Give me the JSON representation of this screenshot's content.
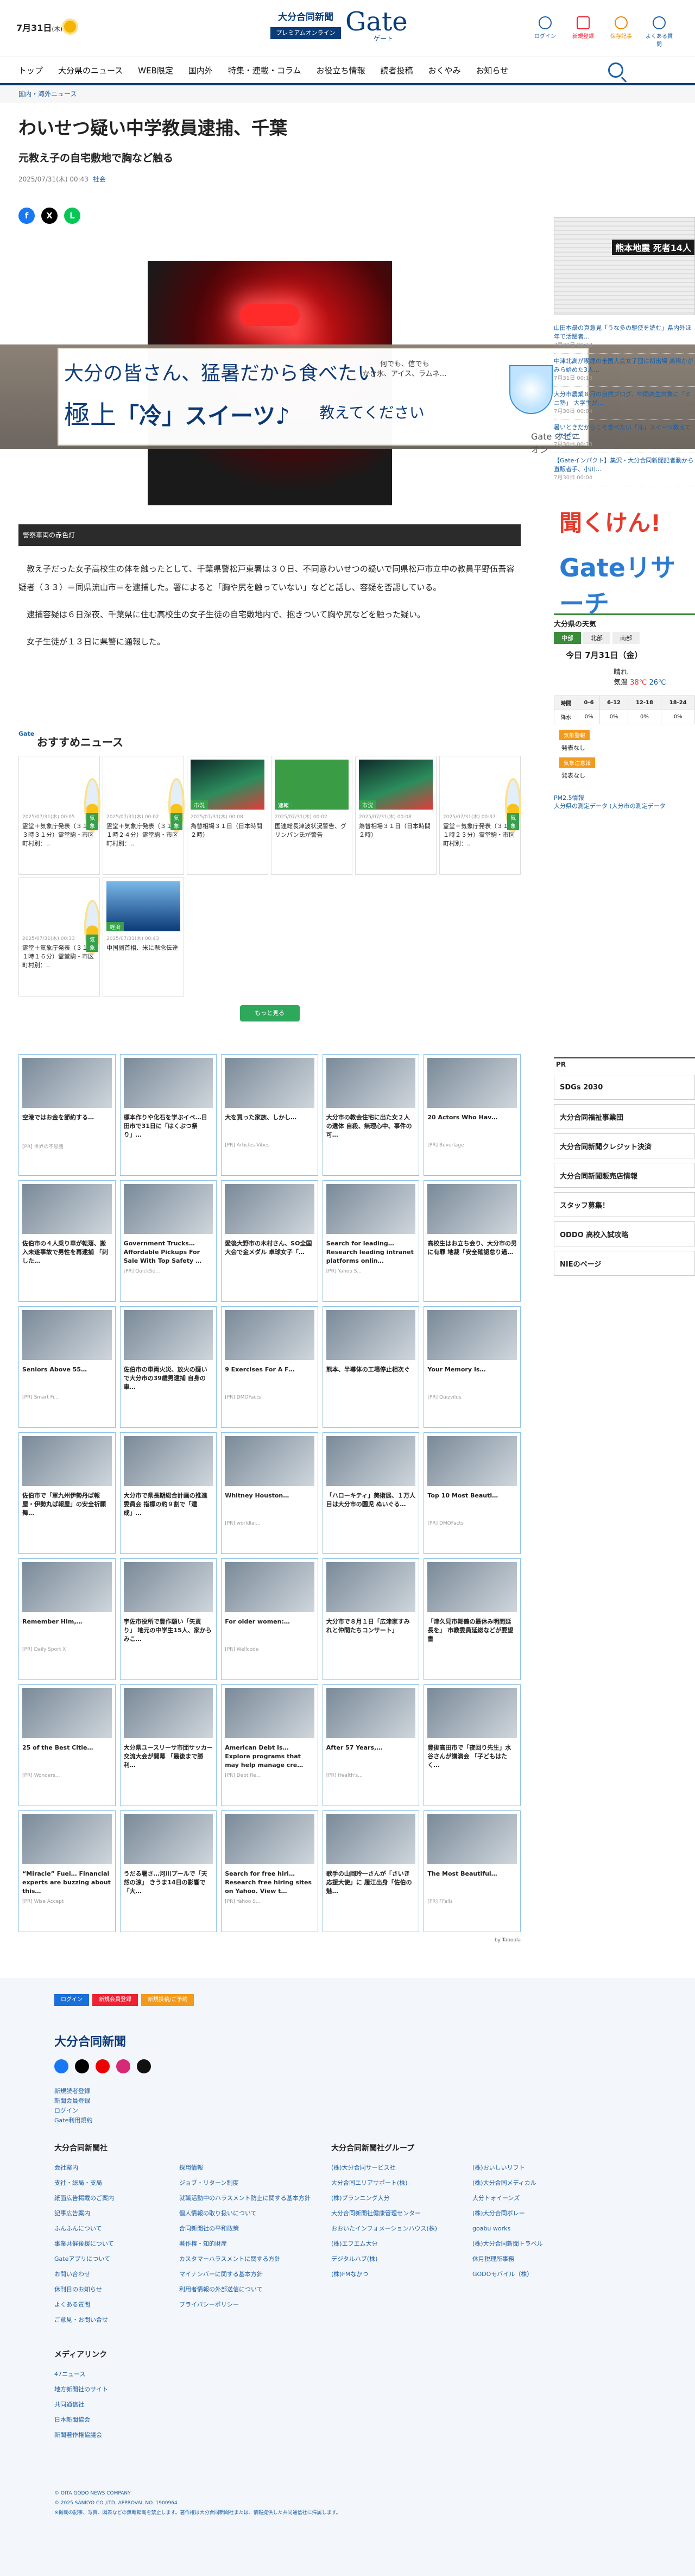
{
  "header": {
    "date": "7月31日",
    "weekday": "(木)",
    "logo_top": "大分合同新聞",
    "logo_sub": "プレミアムオンライン",
    "logo_main": "Gate",
    "logo_kana": "ゲート",
    "icons": [
      {
        "name": "login-icon",
        "label": "ログイン"
      },
      {
        "name": "register-icon",
        "label": "新規登録"
      },
      {
        "name": "bookmark-icon",
        "label": "保存記事"
      },
      {
        "name": "help-icon",
        "label": "よくある質問"
      }
    ]
  },
  "nav": [
    "トップ",
    "大分県のニュース",
    "WEB限定",
    "国内外",
    "特集・連載・コラム",
    "お役立ち情報",
    "読者投稿",
    "おくやみ",
    "お知らせ"
  ],
  "breadcrumb": "国内・海外ニュース",
  "article": {
    "title": "わいせつ疑い中学教員逮捕、千葉",
    "subtitle": "元教え子の自宅敷地で胸など触る",
    "date": "2025/07/31(木) 00:43",
    "tag": "社会",
    "caption": "警察車両の赤色灯",
    "paragraphs": [
      "教え子だった女子高校生の体を触ったとして、千葉県警松戸東署は３０日、不同意わいせつの疑いで同県松戸市立中の教員平野伍吾容疑者（３３）＝同県流山市＝を逮捕した。署によると「胸や尻を触っていない」などと話し、容疑を否認している。",
      "逮捕容疑は６日深夜、千葉県に住む高校生の女子生徒の自宅敷地内で、抱きついて胸や尻などを触った疑い。",
      "女子生徒が１３日に県警に通報した。"
    ]
  },
  "ad": {
    "line1": "大分の皆さん、猛暑だから食べたい",
    "line2a": "極上",
    "line2b": "「冷」スイーツ♪",
    "line3": "教えてください",
    "side_text": "何でも、信でも\nかき氷、アイス、ラムネ…",
    "footer": "Gate オピニオン"
  },
  "recommend": {
    "title": "おすすめニュース",
    "more": "もっと見る",
    "cards": [
      {
        "tag": "気象",
        "time": "2025/07/31(木) 00:05",
        "text": "霊堂＋気象庁発表（３１日３時３１分）霊堂駒・市区町村別：..",
        "kind": "sun"
      },
      {
        "tag": "気象",
        "time": "2025/07/31(木) 00:02",
        "text": "霊堂＋気象庁発表（３１日１時２４分）霊堂駒・市区町村別：..",
        "kind": "sun"
      },
      {
        "tag": "市況",
        "time": "2025/07/31(木) 00:08",
        "text": "為替相場３１日（日本時間２時）",
        "kind": "stock"
      },
      {
        "tag": "速報",
        "time": "2025/07/31(木) 00:02",
        "text": "国連総長津波状況警告、グリンパン氏が警告",
        "kind": "flash"
      },
      {
        "tag": "市況",
        "time": "2025/07/31(木) 00:08",
        "text": "為替相場３１日（日本時間２時）",
        "kind": "stock"
      },
      {
        "tag": "気象",
        "time": "2025/07/31(木) 00:37",
        "text": "霊堂＋気象庁発表（３１日１時２３分）霊堂駒・市区町村別：..",
        "kind": "sun"
      },
      {
        "tag": "気象",
        "time": "2025/07/31(木) 00:33",
        "text": "霊堂＋気象庁発表（３１日１時１６分）霊堂駒・市区町村別：..",
        "kind": "sun"
      },
      {
        "tag": "経済",
        "time": "2025/07/31(木) 00:43",
        "text": "中国副首相、米に懸念伝達",
        "kind": "city"
      }
    ]
  },
  "taboola": {
    "by": "by Taboola",
    "cards": [
      {
        "title": "空港ではお金を節約する…",
        "src": "[PR] 世界の不思議"
      },
      {
        "title": "標本作りや化石を学ぶイベ…日田市で31日に「はくぶつ祭り」…",
        "src": ""
      },
      {
        "title": "大を買った家族、しかし…",
        "src": "[PR] Articles Vibes"
      },
      {
        "title": "大分市の教会住宅に出た女２人の遺体 自殺、無理心中、事件の可…",
        "src": ""
      },
      {
        "title": "20 Actors Who Hav…",
        "src": "[PR] Beverlage"
      },
      {
        "title": "佐伯市の４人乗り車が転落、搬入未遂事故で男性を再逮捕 「刺した…",
        "src": ""
      },
      {
        "title": "Government Trucks… Affordable Pickups For Sale With Top Safety …",
        "src": "[PR] QuickSe..."
      },
      {
        "title": "愛後大野市の木村さん、SO全国大会で金メダル 卓球女子「…",
        "src": ""
      },
      {
        "title": "Search for leading… Research leading intranet platforms onlin…",
        "src": "[PR] Yahoo S..."
      },
      {
        "title": "高校生はお立ち会り、大分市の男に有罪 地裁「安全確認怠り過…",
        "src": ""
      },
      {
        "title": "Seniors Above 55…",
        "src": "[PR] Smart Fi..."
      },
      {
        "title": "佐伯市の車両火災、放火の疑いで大分市の39歳男逮捕 自身の車…",
        "src": ""
      },
      {
        "title": "9 Exercises For A F…",
        "src": "[PR] DMOFacts"
      },
      {
        "title": "熊本、半導体の工場停止相次ぐ",
        "src": ""
      },
      {
        "title": "Your Memory Is…",
        "src": "[PR] Quizvilus"
      },
      {
        "title": "佐伯市で「軍九州伊勢丹ば報屋・伊勢丸ば報屋」の安全祈願 舞…",
        "src": ""
      },
      {
        "title": "大分市で県長期総合計画の推進委員会 指標の約９割で「達成」…",
        "src": ""
      },
      {
        "title": "Whitney Houston…",
        "src": "[PR] worldlai..."
      },
      {
        "title": "「ハローキティ」美術展、１万人目は大分市の園児 ぬいぐる…",
        "src": ""
      },
      {
        "title": "Top 10 Most Beauti…",
        "src": "[PR] DMOFacts"
      },
      {
        "title": "Remember Him,…",
        "src": "[PR] Daily Sport X"
      },
      {
        "title": "宇佐市役所で豊作願い「矢貢り」 地元の中学生15人、家からみこ…",
        "src": ""
      },
      {
        "title": "For older women:…",
        "src": "[PR] Wellcode"
      },
      {
        "title": "大分市で８月１日「広津家すみれと仲間たちコンサート」",
        "src": ""
      },
      {
        "title": "「津久見市舞鶴の最休み明問延長を」 市教委員延総などが要望書",
        "src": ""
      },
      {
        "title": "25 of the Best Citie…",
        "src": "[PR] Wonders..."
      },
      {
        "title": "大分県ユースリーサ市団サッカー交流大会が開幕 「最後まで勝利…",
        "src": ""
      },
      {
        "title": "American Debt Is… Explore programs that may help manage cre…",
        "src": "[PR] Debt Re..."
      },
      {
        "title": "After 57 Years,…",
        "src": "[PR] Health's..."
      },
      {
        "title": "豊後高田市で「夜回り先生」水谷さんが講演会 「子どもはたく…",
        "src": ""
      },
      {
        "title": "“Miracle” Fuel… Financial experts are buzzing about this…",
        "src": "[PR] Wise Accept"
      },
      {
        "title": "うだる暑さ…河川プールで「天然の涼」 きうま14日の影響で「大…",
        "src": ""
      },
      {
        "title": "Search for free hiri… Research free hiring sites on Yahoo. View t…",
        "src": "[PR] Yahoo S..."
      },
      {
        "title": "歌手の山岡玲一さんが「さいき応援大使」に 履江出身「佐伯の魅…",
        "src": ""
      },
      {
        "title": "The Most Beautiful…",
        "src": "[PR] FFalls"
      }
    ]
  },
  "sidebar": {
    "paper_title": "熊本地震 死者14人",
    "news": [
      {
        "text": "山田本最の真意見「うな多の駆使を読む」県内外ほ年で活躍者…",
        "time": "7月30日 00:13"
      },
      {
        "text": "中津北高が喫煙の全国大会女子団に初出場 高稀かがみら始めた3人…",
        "time": "7月31日 00:13"
      },
      {
        "text": "大分市農業８月の自然ブログ、中間高生対象に「ミニ塾」 大学生が…",
        "time": "7月30日 00:04"
      },
      {
        "text": "暑いときだからこそ食べたい「冷」スイーツ教えてください",
        "time": "7月30日 00:13"
      },
      {
        "text": "【Gateインパクト】集沢・大分合同新聞記者動から 直販者手、小川…",
        "time": "7月30日 00:04"
      }
    ],
    "banner_a": "聞くけん!",
    "banner_b": "Gateリサーチ",
    "weather": {
      "title": "大分県の天気",
      "tabs": [
        "中部",
        "北部",
        "南部"
      ],
      "date": "今日 7月31日（金）",
      "condition": "晴れ",
      "high": "38℃",
      "low": "26℃",
      "label_temp": "気温",
      "headers": [
        "時間",
        "0-6",
        "6-12",
        "12-18",
        "18-24"
      ],
      "rain": [
        "降水",
        "0%",
        "0%",
        "0%",
        "0%"
      ],
      "warn_label": "気象警報",
      "warn": "発表なし",
      "adv_label": "気象注意報",
      "adv": "発表なし"
    },
    "pm": "PM2.5情報\n大分県の測定データ (大分市の測定データ",
    "pr_title": "PR",
    "pr_banners": [
      "SDGs 2030",
      "大分合同福祉事業団",
      "大分合同新聞クレジット決済",
      "大分合同新聞販売店情報",
      "スタッフ募集！",
      "ODDO 高校入試攻略",
      "NIEのページ"
    ]
  },
  "footer": {
    "buttons": [
      "ログイン",
      "新規会員登録",
      "新規投稿/ご予約"
    ],
    "logo": "大分合同新聞",
    "links": [
      "新規読者登録",
      "新聞会員登録",
      "ログイン",
      "Gate利用規約"
    ],
    "company_title": "大分合同新聞社",
    "company_left": [
      "会社案内",
      "支社・総局・支局",
      "紙面広告掲載のご案内",
      "記事広告案内",
      "ふんふんについて",
      "事業共催後援について",
      "Gateアプリについて",
      "お問い合わせ",
      "休刊日のお知らせ",
      "よくある質問",
      "ご意見・お問い合せ"
    ],
    "company_right": [
      "採用情報",
      "ジョブ・リターン制度",
      "就職活動中のハラスメント防止に関する基本方針",
      "個人情報の取り扱いについて",
      "合同新聞社の平和政策",
      "著作権・知的財産",
      "カスタマーハラスメントに関する方針",
      "マイナンバーに関する基本方針",
      "利用者情報の外部送信について",
      "プライバシーポリシー"
    ],
    "group_title": "大分合同新聞社グループ",
    "group_left": [
      "(株)大分合同サービス社",
      "大分合同エリアサポート(株)",
      "(株)プランニング大分",
      "大分合同新聞社健康管理センター",
      "おおいたインフォメーションハウス(株)",
      "(株)エフエム大分",
      "デジタルハブ(株)",
      "(株)FMなかつ"
    ],
    "group_right": [
      "(株)おいしいリフト",
      "(株)大分合同メディカル",
      "大分トォイーンズ",
      "(株)大分合同ボレー",
      "goabu works",
      "(株)大分合同新聞トラベル",
      "休月税理所事務",
      "GODOモバイル（株）"
    ],
    "media_title": "メディアリンク",
    "media": [
      "47ニュース",
      "地方新聞社のサイト",
      "共同通信社",
      "日本新聞協会",
      "新聞著作権協議会"
    ],
    "copy": "© OITA GODO NEWS COMPANY\n© 2025 SANKYO CO.,LTD. APPROVAL NO. 1900964\n※掲載の記事、写真、図表などの無断転載を禁止します。著作権は大分合同新聞社または、情報提供した共同通信社に帰属します。"
  }
}
